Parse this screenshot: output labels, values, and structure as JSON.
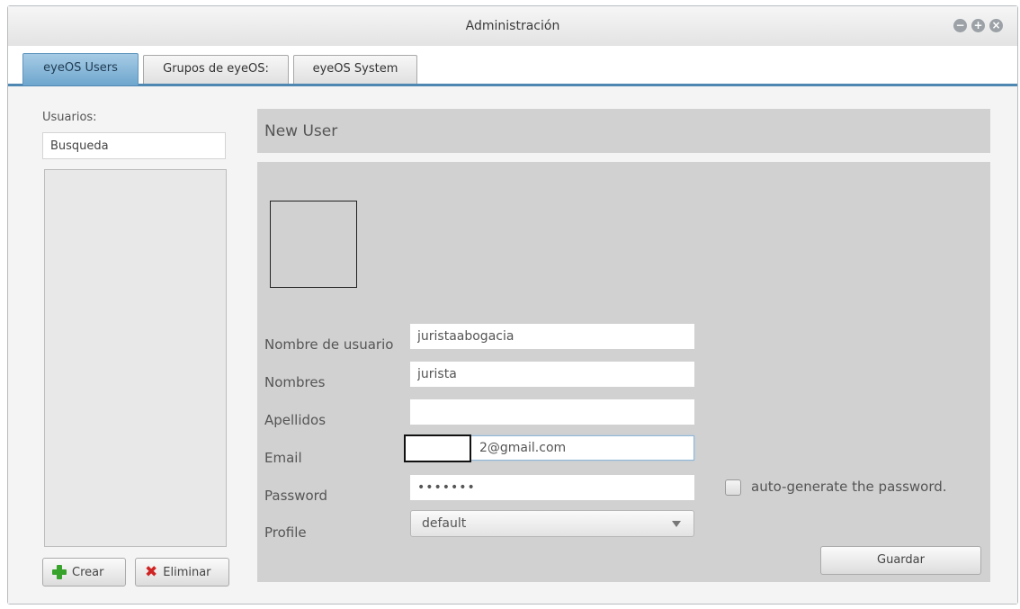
{
  "window": {
    "title": "Administración",
    "controls": [
      "minimize-icon",
      "maximize-icon",
      "close-icon"
    ]
  },
  "tabs": [
    {
      "label": "eyeOS Users",
      "active": true
    },
    {
      "label": "Grupos de eyeOS:",
      "active": false
    },
    {
      "label": "eyeOS System",
      "active": false
    }
  ],
  "sidebar": {
    "users_label": "Usuarios:",
    "search_value": "Busqueda",
    "create_label": "Crear",
    "delete_label": "Eliminar"
  },
  "form": {
    "header": "New User",
    "fields": {
      "username": {
        "label": "Nombre de usuario",
        "value": "juristaabogacia"
      },
      "names": {
        "label": "Nombres",
        "value": "jurista"
      },
      "surnames": {
        "label": "Apellidos",
        "value": ""
      },
      "email": {
        "label": "Email",
        "value": "2@gmail.com"
      },
      "password": {
        "label": "Password",
        "value": "•••••••"
      },
      "profile": {
        "label": "Profile",
        "value": "default"
      }
    },
    "autogen_label": "auto-generate the password.",
    "save_label": "Guardar"
  },
  "colors": {
    "tab_active": "#6ea6cd",
    "accent_border": "#4f87b3",
    "panel_bg": "#d1d1d1",
    "create_icon": "#37a32b",
    "delete_icon": "#d02424"
  }
}
